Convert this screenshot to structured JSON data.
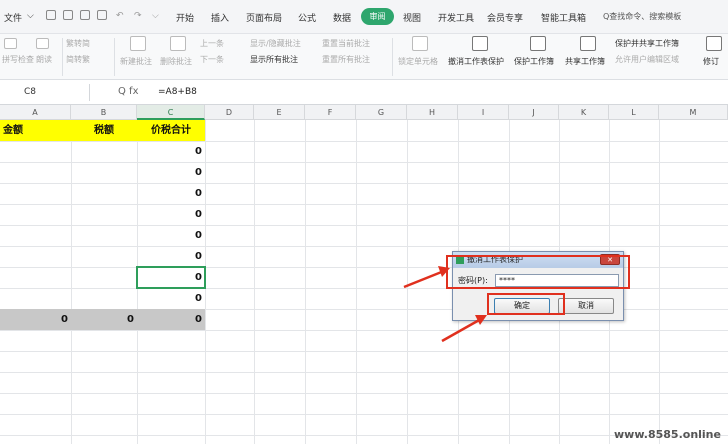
{
  "menubar": {
    "file": "文件",
    "dropdown": "⌵",
    "tabs": [
      "开始",
      "插入",
      "页面布局",
      "公式",
      "数据",
      "审阅",
      "视图",
      "开发工具",
      "会员专享",
      "智能工具箱"
    ],
    "active_tab": "审阅",
    "search_placeholder": "Q查找命令、搜索模板"
  },
  "ribbon": {
    "spellcheck": "拼写检查",
    "read_aloud": "朗读",
    "trad_to_simp": "繁转简",
    "simp_to_trad": "简转繁",
    "new_comment": "新建批注",
    "delete_comment": "删除批注",
    "prev_comment": "上一条",
    "next_comment": "下一条",
    "show_hide_comment": "显示/隐藏批注",
    "show_all_comments": "显示所有批注",
    "reset_current_comment": "重置当前批注",
    "reset_all_comments": "重置所有批注",
    "lock_cell": "锁定单元格",
    "unprotect_sheet": "撤消工作表保护",
    "protect_workbook": "保护工作簿",
    "share_workbook": "共享工作簿",
    "protect_share_workbook": "保护并共享工作簿",
    "allow_edit_ranges": "允许用户编辑区域",
    "track_changes": "修订"
  },
  "formula_bar": {
    "cell_ref": "C8",
    "fx_icons": "Q  fx",
    "formula": "=A8+B8"
  },
  "columns": [
    "A",
    "B",
    "C",
    "D",
    "E",
    "F",
    "G",
    "H",
    "I",
    "J",
    "K",
    "L",
    "M"
  ],
  "sheet": {
    "header_a": "金额",
    "header_b": "税额",
    "header_c": "价税合计",
    "c_values": [
      "0",
      "0",
      "0",
      "0",
      "0",
      "0",
      "0",
      "0"
    ],
    "total_a": "0",
    "total_b": "0",
    "total_c": "0"
  },
  "dialog": {
    "title": "撤消工作表保护",
    "close": "✕",
    "password_label": "密码(P):",
    "password_value": "****",
    "ok": "确定",
    "cancel": "取消"
  },
  "watermark": "www.8585.online"
}
